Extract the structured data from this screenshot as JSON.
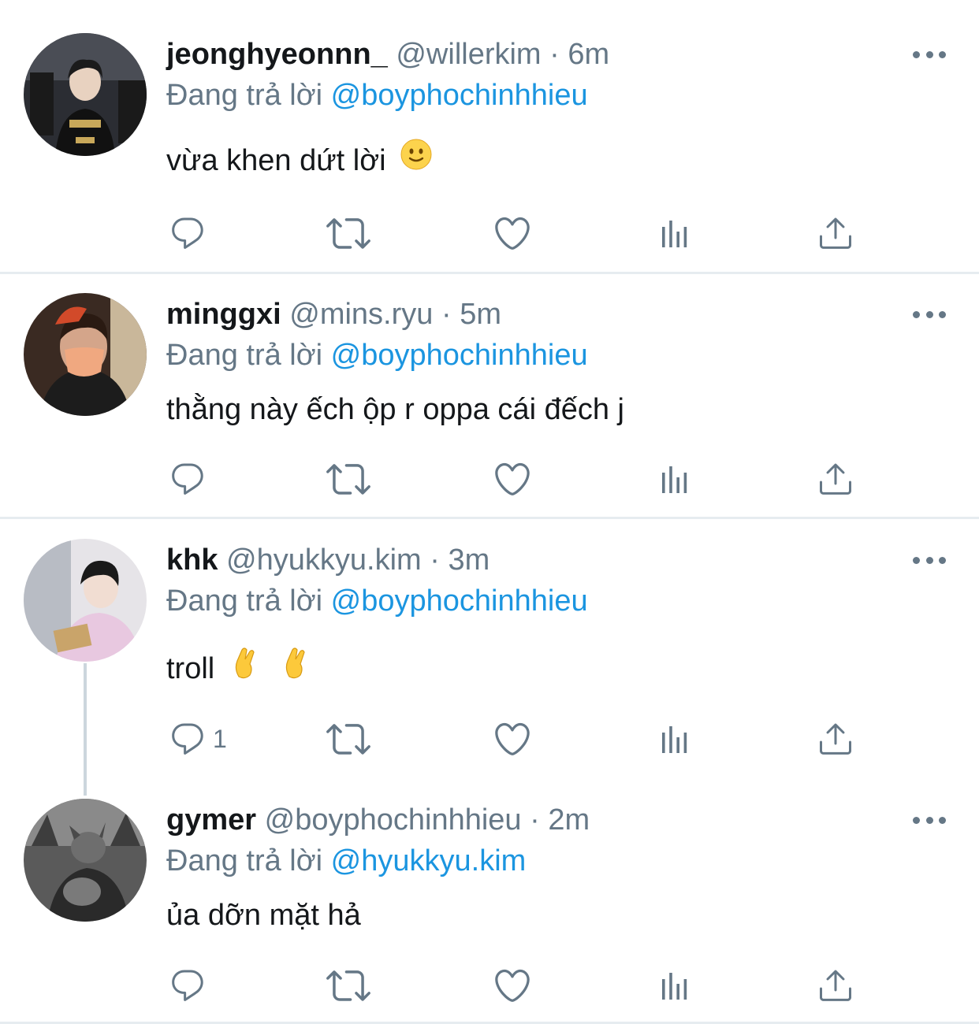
{
  "tweets": [
    {
      "display_name": "jeonghyeonnn_",
      "handle": "@willerkim",
      "sep": "·",
      "time": "6m",
      "replying_prefix": "Đang trả lời",
      "replying_to": "@boyphochinhhieu",
      "text": "vừa khen dứt lời",
      "emoji": "🙂",
      "reply_count": ""
    },
    {
      "display_name": "minggxi",
      "handle": "@mins.ryu",
      "sep": "·",
      "time": "5m",
      "replying_prefix": "Đang trả lời",
      "replying_to": "@boyphochinhhieu",
      "text": "thằng này ếch ộp r oppa cái đếch j",
      "reply_count": ""
    },
    {
      "display_name": "khk",
      "handle": "@hyukkyu.kim",
      "sep": "·",
      "time": "3m",
      "replying_prefix": "Đang trả lời",
      "replying_to": "@boyphochinhhieu",
      "text": "troll",
      "emoji": "🤞 🤞",
      "reply_count": "1"
    },
    {
      "display_name": "gymer",
      "handle": "@boyphochinhhieu",
      "sep": "·",
      "time": "2m",
      "replying_prefix": "Đang trả lời",
      "replying_to": "@hyukkyu.kim",
      "text": "ủa dỡn mặt hả",
      "reply_count": ""
    }
  ],
  "icons": {
    "reply": "reply-icon",
    "retweet": "retweet-icon",
    "like": "heart-icon",
    "analytics": "analytics-icon",
    "share": "share-icon",
    "more": "more-icon"
  },
  "colors": {
    "link": "#1b95e0",
    "secondary_text": "#657786",
    "divider": "#e6ecf0",
    "thread_line": "#ccd6dd"
  }
}
